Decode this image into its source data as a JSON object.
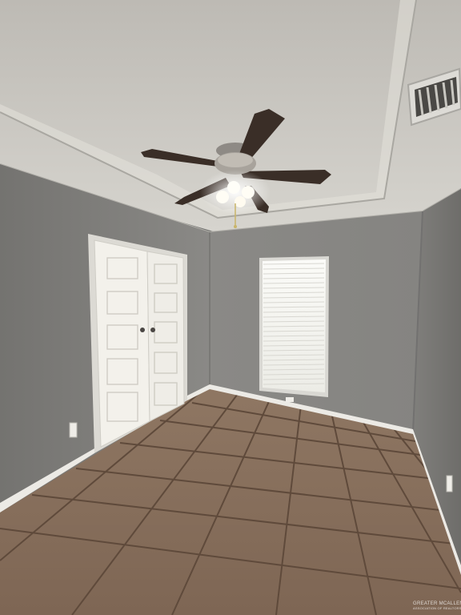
{
  "photo": {
    "subject": "empty-bedroom",
    "colors": {
      "ceiling": "#cfcdc7",
      "tray_band": "#c4c1bb",
      "left_wall": "#807f7c",
      "back_wall": "#8b8a87",
      "right_wall": "#7a7976",
      "floor_tile": "#8c7460",
      "grout": "#5a473a",
      "baseboard": "#eceae5",
      "door": "#f2f0ea",
      "window_light": "#f7f7f4",
      "fan_blade": "#3a2e27"
    },
    "fixtures": [
      "ceiling-fan",
      "hvac-vent",
      "closet-double-door",
      "window-blinds",
      "electrical-outlet",
      "floor-tiles",
      "baseboard"
    ]
  },
  "watermark": {
    "brand": "GREATER MCALLEN",
    "sub": "ASSOCIATION OF REALTORS"
  }
}
